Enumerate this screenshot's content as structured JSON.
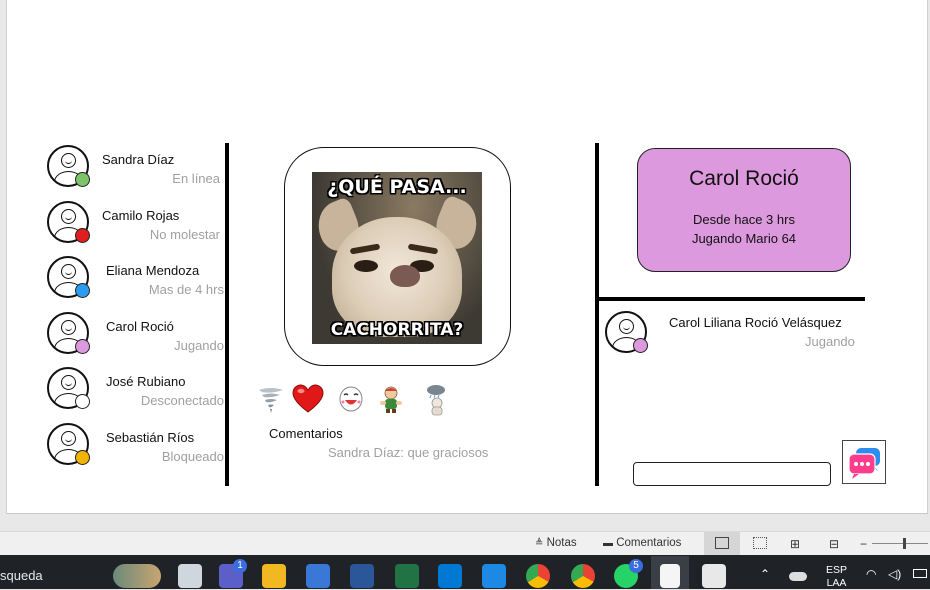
{
  "contacts": [
    {
      "name": "Sandra Díaz",
      "status": "En línea",
      "status_color": "#7cc36a"
    },
    {
      "name": "Camilo Rojas",
      "status": "No molestar",
      "status_color": "#e11d1d"
    },
    {
      "name": "Eliana Mendoza",
      "status": "Mas de 4 hrs",
      "status_color": "#2d9bf0"
    },
    {
      "name": "Carol Roció",
      "status": "Jugando",
      "status_color": "#dd99dd"
    },
    {
      "name": "José Rubiano",
      "status": "Desconectado",
      "status_color": "#ffffff"
    },
    {
      "name": "Sebastián Ríos",
      "status": "Bloqueado",
      "status_color": "#f0b400"
    }
  ],
  "post": {
    "meme_top_text": "¿QUÉ PASA...",
    "meme_bottom_text": "CACHORRITA?",
    "reactions": [
      "tornado-icon",
      "heart-icon",
      "laughing-face-icon",
      "character-icon",
      "rain-cloud-icon"
    ],
    "comments_title": "Comentarios",
    "comments": [
      {
        "text": "Sandra Díaz: que graciosos"
      }
    ]
  },
  "profile": {
    "name": "Carol Roció",
    "since": "Desde hace 3 hrs",
    "activity": "Jugando Mario 64",
    "card_color": "#dd99dd"
  },
  "chat": {
    "contact_name": "Carol Liliana Roció Velásquez",
    "contact_status": "Jugando",
    "status_color": "#dd99dd",
    "input_value": ""
  },
  "statusbar": {
    "notes_label": "Notas",
    "comments_label": "Comentarios"
  },
  "taskbar": {
    "search_text": "squeda",
    "teams_badge": "1",
    "whatsapp_badge": "5",
    "lang_top": "ESP",
    "lang_bottom": "LAA"
  }
}
